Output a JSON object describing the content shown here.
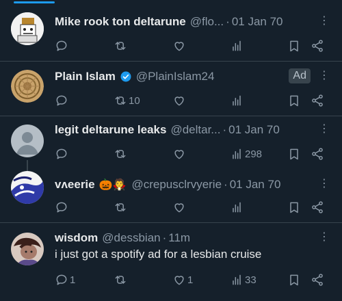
{
  "tweets": [
    {
      "name": "Mike rook ton deltarune",
      "handle": "@flo...",
      "time": "01 Jan 70",
      "actions": {
        "reply": "",
        "retweet": "",
        "like": "",
        "views": ""
      },
      "icons": [
        "reply-icon",
        "retweet-icon",
        "like-icon",
        "views-icon",
        "bookmark-icon",
        "share-icon"
      ]
    },
    {
      "name": "Plain Islam",
      "handle": "@PlainIslam24",
      "badge": "Ad",
      "actions": {
        "reply": "",
        "retweet": "10",
        "like": "",
        "views": ""
      }
    },
    {
      "name": "legit deltarune leaks",
      "handle": "@deltar...",
      "time": "01 Jan 70",
      "actions": {
        "reply": "",
        "retweet": "",
        "like": "",
        "views": "298"
      }
    },
    {
      "name": "vʌeerie",
      "handle": "@crepusclrvyerie",
      "time": "01 Jan 70",
      "emoji": "🎃🧛",
      "actions": {
        "reply": "",
        "retweet": "",
        "like": "",
        "views": ""
      }
    },
    {
      "name": "wisdom",
      "handle": "@dessbian",
      "time": "11m",
      "text": "i just got a spotify ad for a lesbian cruise",
      "actions": {
        "reply": "1",
        "retweet": "",
        "like": "1",
        "views": "33"
      }
    }
  ],
  "colors": {
    "background": "#15202b",
    "accent": "#1d9bf0",
    "muted": "#8b98a5",
    "divider": "#38444d"
  }
}
